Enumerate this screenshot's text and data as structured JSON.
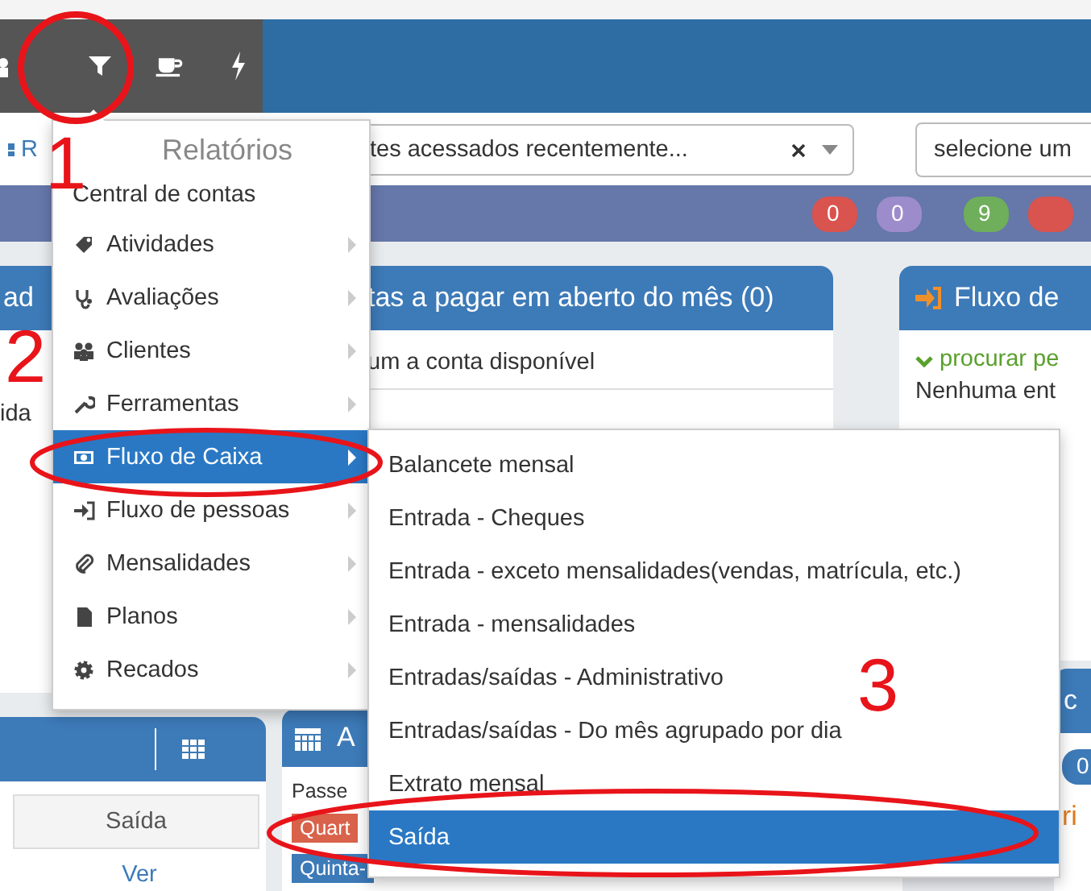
{
  "recent_field": {
    "value": "tes acessados recentemente..."
  },
  "select_field": {
    "placeholder": "selecione um"
  },
  "left_link": "R",
  "badges": [
    {
      "text": "0",
      "color": "#d9534f"
    },
    {
      "text": "0",
      "color": "#9d8ccc"
    },
    {
      "text": "9",
      "color": "#6fae5a"
    },
    {
      "color": "#d9534f"
    }
  ],
  "panels": {
    "upper_left": {
      "title": "ad",
      "body": "ida"
    },
    "upper_middle": {
      "title": "tas a pagar em aberto do mês (0)",
      "body": "um a conta disponível"
    },
    "upper_right": {
      "title": "Fluxo de",
      "link": "procurar pe",
      "body": "Nenhuma ent"
    },
    "lower_left": {
      "column": "Saída",
      "link": "Ver"
    },
    "lower_middle": {
      "title": "A",
      "body": "Passe",
      "tags": [
        {
          "text": "Quart",
          "color": "#d9624a"
        },
        {
          "text": "Quinta-",
          "color": "#3d7ab8"
        }
      ]
    },
    "lower_right": {
      "title": "c",
      "badge": "0",
      "body": "ri"
    }
  },
  "menu": {
    "title": "Relatórios",
    "items": [
      {
        "label": "Central de contas",
        "kind": "plain",
        "selected": false
      },
      {
        "label": "Atividades",
        "kind": "submenu",
        "selected": false
      },
      {
        "label": "Avaliações",
        "kind": "submenu",
        "selected": false
      },
      {
        "label": "Clientes",
        "kind": "submenu",
        "selected": false
      },
      {
        "label": "Ferramentas",
        "kind": "submenu",
        "selected": false
      },
      {
        "label": "Fluxo de Caixa",
        "kind": "submenu",
        "selected": true
      },
      {
        "label": "Fluxo de pessoas",
        "kind": "submenu",
        "selected": false
      },
      {
        "label": "Mensalidades",
        "kind": "submenu",
        "selected": false
      },
      {
        "label": "Planos",
        "kind": "submenu",
        "selected": false
      },
      {
        "label": "Recados",
        "kind": "submenu",
        "selected": false
      }
    ]
  },
  "submenu": {
    "items": [
      {
        "label": "Balancete mensal",
        "selected": false
      },
      {
        "label": "Entrada - Cheques",
        "selected": false
      },
      {
        "label": "Entrada - exceto mensalidades(vendas, matrícula, etc.)",
        "selected": false
      },
      {
        "label": "Entrada - mensalidades",
        "selected": false
      },
      {
        "label": "Entradas/saídas - Administrativo",
        "selected": false
      },
      {
        "label": "Entradas/saídas - Do mês agrupado por dia",
        "selected": false
      },
      {
        "label": "Extrato mensal",
        "selected": false
      },
      {
        "label": "Saída",
        "selected": true
      }
    ]
  },
  "annotations": [
    "1",
    "2",
    "3"
  ]
}
